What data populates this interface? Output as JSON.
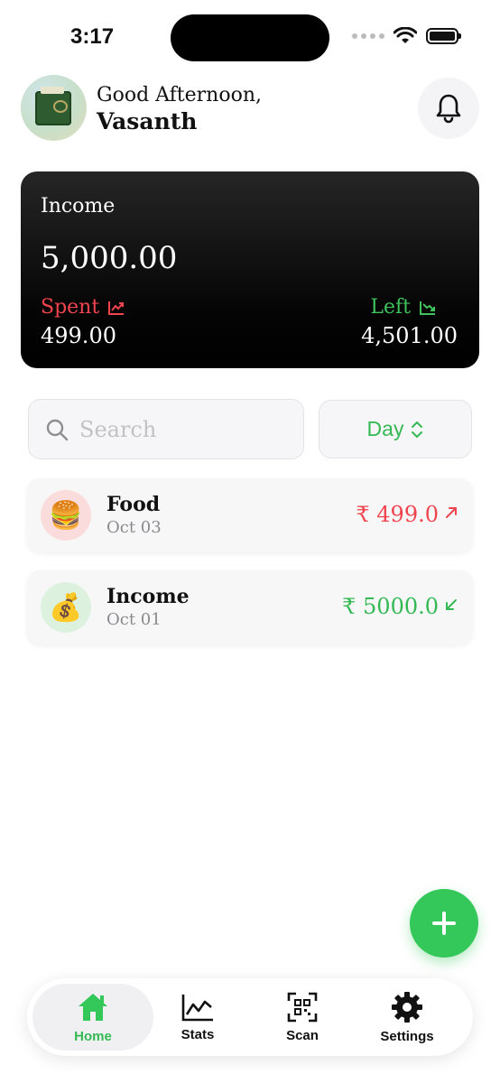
{
  "status_bar": {
    "time": "3:17"
  },
  "header": {
    "greeting": "Good Afternoon,",
    "username": "Vasanth"
  },
  "summary_card": {
    "title": "Income",
    "amount": "5,000.00",
    "spent_label": "Spent",
    "spent_value": "499.00",
    "left_label": "Left",
    "left_value": "4,501.00"
  },
  "search": {
    "placeholder": "Search",
    "value": ""
  },
  "period_picker": {
    "selected": "Day"
  },
  "transactions": [
    {
      "title": "Food",
      "date": "Oct 03",
      "amount": "₹ 499.0",
      "icon": "burger-emoji",
      "emoji": "🍔",
      "type": "expense"
    },
    {
      "title": "Income",
      "date": "Oct 01",
      "amount": "₹ 5000.0",
      "icon": "money-bag-emoji",
      "emoji": "💰",
      "type": "income"
    }
  ],
  "tabs": [
    {
      "label": "Home",
      "icon": "home-icon",
      "active": true
    },
    {
      "label": "Stats",
      "icon": "chart-icon",
      "active": false
    },
    {
      "label": "Scan",
      "icon": "qr-scan-icon",
      "active": false
    },
    {
      "label": "Settings",
      "icon": "gear-icon",
      "active": false
    }
  ],
  "colors": {
    "accent": "#34c759",
    "expense": "#f0444e",
    "income": "#34b954"
  }
}
